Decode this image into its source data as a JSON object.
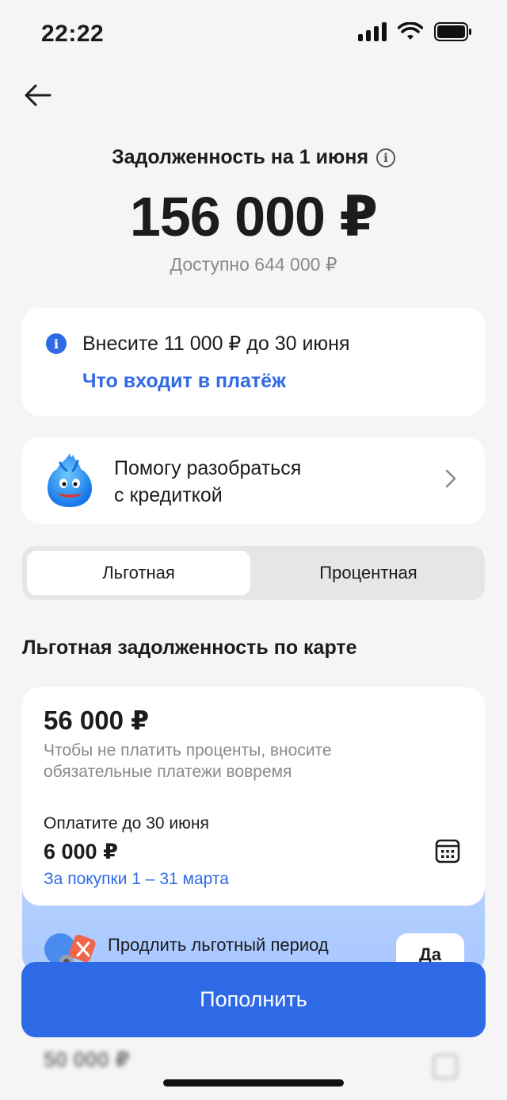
{
  "status_bar": {
    "time": "22:22"
  },
  "header": {
    "debt_title": "Задолженность на 1 июня",
    "debt_amount": "156 000 ₽",
    "available": "Доступно 644 000 ₽"
  },
  "payment_card": {
    "text": "Внесите 11 000 ₽ до 30 июня",
    "link": "Что входит в платёж"
  },
  "helper_card": {
    "line1": "Помогу разобраться",
    "line2": "с кредиткой"
  },
  "tabs": [
    {
      "label": "Льготная",
      "selected": true
    },
    {
      "label": "Процентная",
      "selected": false
    }
  ],
  "section_title": "Льготная задолженность по карте",
  "grace_card": {
    "amount": "56 000 ₽",
    "note": "Чтобы не платить проценты, вносите обязательные платежи вовремя",
    "pay_until": "Оплатите до 30 июня",
    "pay_amount": "6 000 ₽",
    "pay_period": "За покупки 1 – 31 марта"
  },
  "extend": {
    "text": "Продлить льготный период",
    "button": "Да"
  },
  "blurred": {
    "amount": "50 000 ₽"
  },
  "topup_button": "Пополнить",
  "colors": {
    "accent": "#2f6ae6",
    "background": "#f5f5f6"
  }
}
